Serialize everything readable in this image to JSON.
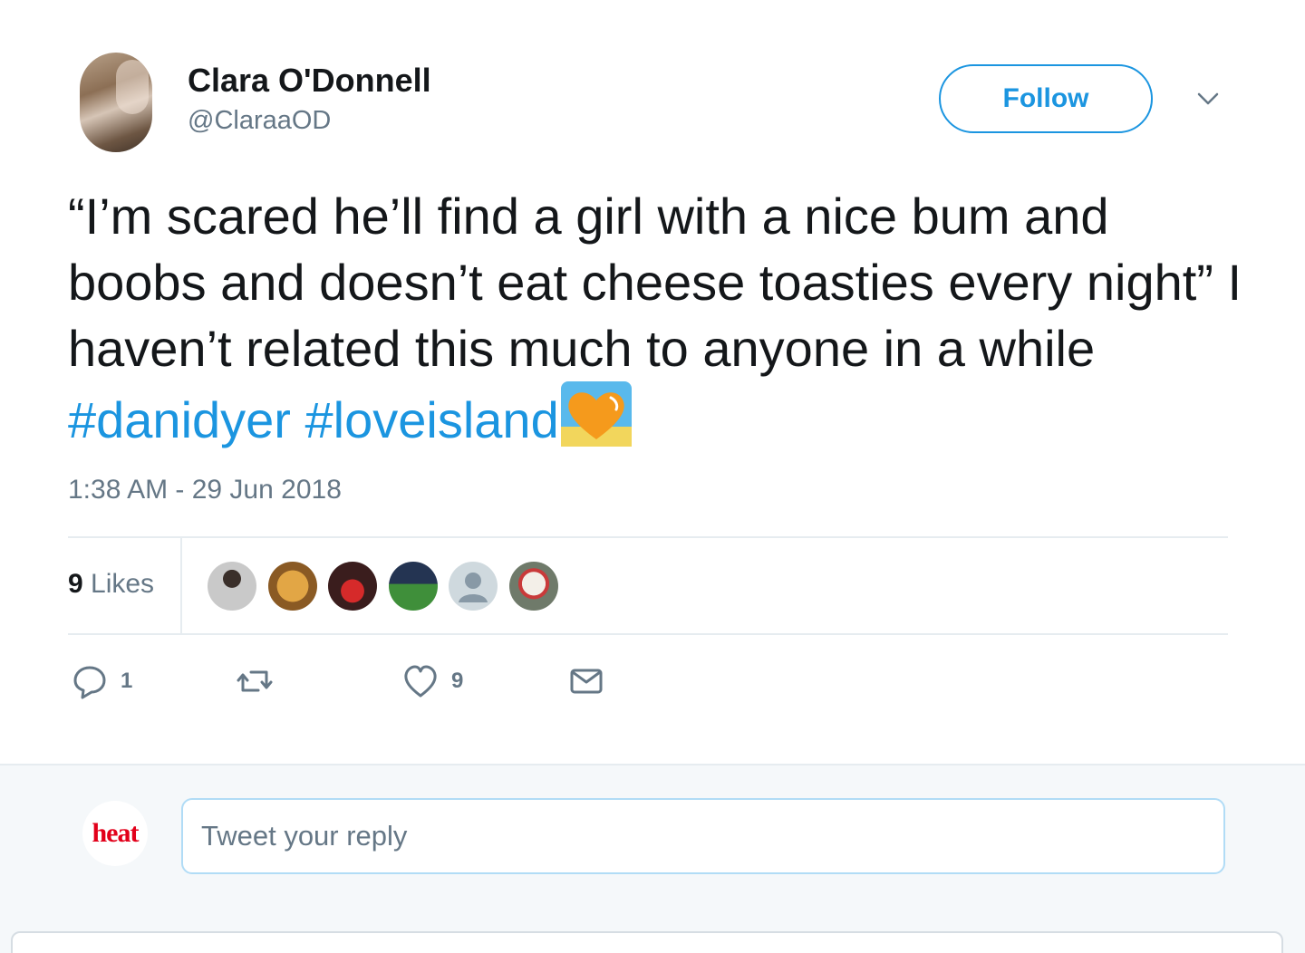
{
  "user": {
    "name": "Clara O'Donnell",
    "handle": "@ClaraaOD",
    "avatar_icon": "user-avatar-photo"
  },
  "header": {
    "follow_label": "Follow",
    "menu_icon": "chevron-down-icon"
  },
  "tweet": {
    "text_part1": "“I’m scared he’ll find a girl with a nice bum and boobs and doesn’t eat cheese toasties every night” I haven’t related this much to anyone in a while ",
    "hashtag1": "#danidyer",
    "hashtag2": "#loveisland",
    "emoji_icon": "orange-heart-emoji",
    "timestamp": "1:38 AM - 29 Jun 2018"
  },
  "likes": {
    "count": "9",
    "label": " Likes"
  },
  "actions": {
    "reply_count": "1",
    "retweet_count": "",
    "like_count": "9"
  },
  "reply": {
    "avatar_text": "heat",
    "placeholder": "Tweet your reply"
  },
  "colors": {
    "accent": "#1b95e0",
    "secondary_text": "#657786",
    "divider": "#e6ecf0",
    "reply_bg": "#f5f8fa",
    "heat_red": "#e2001a"
  }
}
